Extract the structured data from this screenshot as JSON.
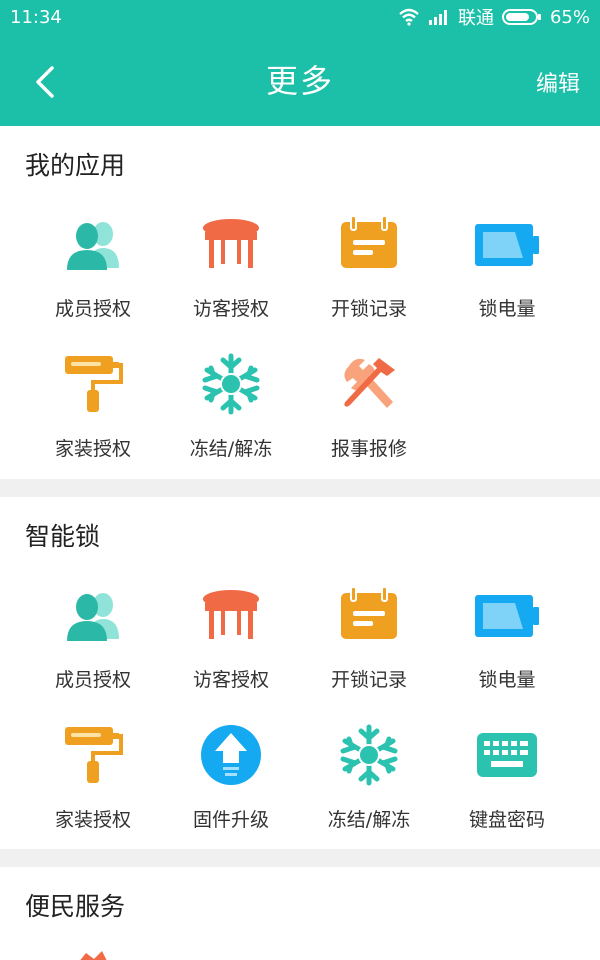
{
  "status": {
    "time": "11:34",
    "carrier": "联通",
    "battery": "65%"
  },
  "header": {
    "title": "更多",
    "edit_label": "编辑"
  },
  "sections": [
    {
      "title": "我的应用",
      "items": [
        {
          "label": "成员授权",
          "icon": "members-icon"
        },
        {
          "label": "访客授权",
          "icon": "table-icon"
        },
        {
          "label": "开锁记录",
          "icon": "calendar-icon"
        },
        {
          "label": "锁电量",
          "icon": "battery-icon"
        },
        {
          "label": "家装授权",
          "icon": "paint-roller-icon"
        },
        {
          "label": "冻结/解冻",
          "icon": "snowflake-icon"
        },
        {
          "label": "报事报修",
          "icon": "tools-icon"
        }
      ]
    },
    {
      "title": "智能锁",
      "items": [
        {
          "label": "成员授权",
          "icon": "members-icon"
        },
        {
          "label": "访客授权",
          "icon": "table-icon"
        },
        {
          "label": "开锁记录",
          "icon": "calendar-icon"
        },
        {
          "label": "锁电量",
          "icon": "battery-icon"
        },
        {
          "label": "家装授权",
          "icon": "paint-roller-icon"
        },
        {
          "label": "固件升级",
          "icon": "upgrade-icon"
        },
        {
          "label": "冻结/解冻",
          "icon": "snowflake-icon"
        },
        {
          "label": "键盘密码",
          "icon": "keyboard-icon"
        }
      ]
    },
    {
      "title": "便民服务",
      "items": []
    }
  ],
  "colors": {
    "brand": "#1cbfa7",
    "orange": "#f0a020",
    "red": "#f06a45",
    "blue": "#14a9f0",
    "teal": "#2bc2b0"
  }
}
